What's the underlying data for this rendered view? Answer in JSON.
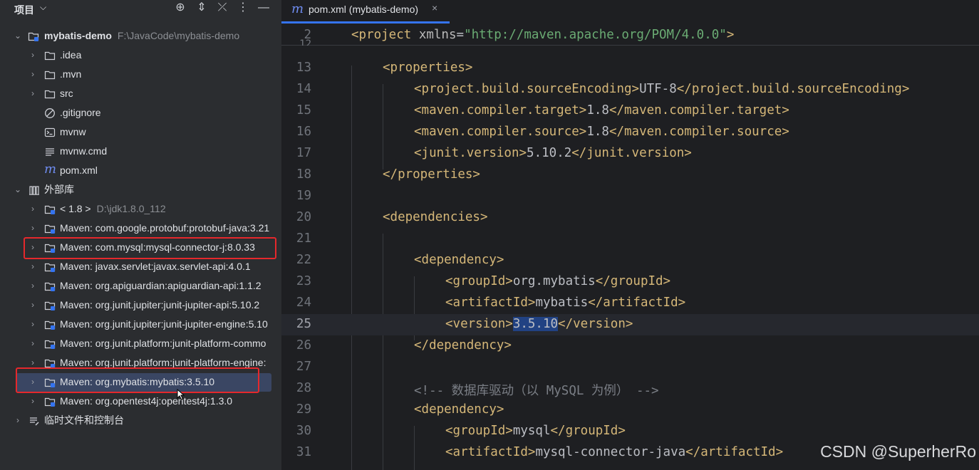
{
  "project_panel": {
    "title": "项目",
    "tree": [
      {
        "label": "mybatis-demo",
        "hint": "F:\\JavaCode\\mybatis-demo",
        "expanded": true,
        "icon": "module-folder-icon"
      },
      {
        "label": ".idea",
        "icon": "folder-icon"
      },
      {
        "label": ".mvn",
        "icon": "folder-icon"
      },
      {
        "label": "src",
        "icon": "folder-icon"
      },
      {
        "label": ".gitignore",
        "icon": "gitignore-icon"
      },
      {
        "label": "mvnw",
        "icon": "terminal-file-icon"
      },
      {
        "label": "mvnw.cmd",
        "icon": "text-file-icon"
      },
      {
        "label": "pom.xml",
        "icon": "maven-file-icon"
      },
      {
        "label": "外部库",
        "expanded": true,
        "icon": "library-icon"
      },
      {
        "label": "< 1.8 >",
        "hint": "D:\\jdk1.8.0_112",
        "icon": "jdk-icon"
      },
      {
        "label": "Maven: com.google.protobuf:protobuf-java:3.21",
        "icon": "maven-library-icon"
      },
      {
        "label": "Maven: com.mysql:mysql-connector-j:8.0.33",
        "icon": "maven-library-icon",
        "highlighted": true
      },
      {
        "label": "Maven: javax.servlet:javax.servlet-api:4.0.1",
        "icon": "maven-library-icon"
      },
      {
        "label": "Maven: org.apiguardian:apiguardian-api:1.1.2",
        "icon": "maven-library-icon"
      },
      {
        "label": "Maven: org.junit.jupiter:junit-jupiter-api:5.10.2",
        "icon": "maven-library-icon"
      },
      {
        "label": "Maven: org.junit.jupiter:junit-jupiter-engine:5.10",
        "icon": "maven-library-icon"
      },
      {
        "label": "Maven: org.junit.platform:junit-platform-commo",
        "icon": "maven-library-icon"
      },
      {
        "label": "Maven: org.junit.platform:junit-platform-engine:",
        "icon": "maven-library-icon"
      },
      {
        "label": "Maven: org.mybatis:mybatis:3.5.10",
        "icon": "maven-library-icon",
        "highlighted": true,
        "selected": true
      },
      {
        "label": "Maven: org.opentest4j:opentest4j:1.3.0",
        "icon": "maven-library-icon"
      },
      {
        "label": "临时文件和控制台",
        "icon": "scratches-icon"
      }
    ]
  },
  "editor": {
    "tab": {
      "title": "pom.xml (mybatis-demo)",
      "icon": "maven-file-icon"
    },
    "sticky": {
      "number": "2",
      "open": "<project ",
      "attr": "xmlns",
      "eq": "=",
      "value": "\"http://maven.apache.org/POM/4.0.0\""
    },
    "lines": [
      {
        "n": "13",
        "text": "<properties>"
      },
      {
        "n": "14",
        "text": "<project.build.sourceEncoding>UTF-8</project.build.sourceEncoding>"
      },
      {
        "n": "15",
        "text": "<maven.compiler.target>1.8</maven.compiler.target>"
      },
      {
        "n": "16",
        "text": "<maven.compiler.source>1.8</maven.compiler.source>"
      },
      {
        "n": "17",
        "text": "<junit.version>5.10.2</junit.version>"
      },
      {
        "n": "18",
        "text": "</properties>"
      },
      {
        "n": "19",
        "text": ""
      },
      {
        "n": "20",
        "text": "<dependencies>"
      },
      {
        "n": "21",
        "text": ""
      },
      {
        "n": "22",
        "text": "<dependency>"
      },
      {
        "n": "23",
        "text": "<groupId>org.mybatis</groupId>"
      },
      {
        "n": "24",
        "text": "<artifactId>mybatis</artifactId>"
      },
      {
        "n": "25",
        "text": "<version>3.5.10</version>",
        "current": true,
        "selected_text": "3.5.10"
      },
      {
        "n": "26",
        "text": "</dependency>"
      },
      {
        "n": "27",
        "text": ""
      },
      {
        "n": "28",
        "text": "<!-- 数据库驱动（以 MySQL 为例） -->"
      },
      {
        "n": "29",
        "text": "<dependency>"
      },
      {
        "n": "30",
        "text": "<groupId>mysql</groupId>"
      },
      {
        "n": "31",
        "text": "<artifactId>mysql-connector-java</artifactId>"
      }
    ]
  },
  "watermark": "CSDN @SuperherRo",
  "colors": {
    "tag": "#d5b778",
    "string": "#6aab73",
    "comment": "#7a7e85",
    "selection": "#214283",
    "highlight_box": "#e5282c"
  }
}
